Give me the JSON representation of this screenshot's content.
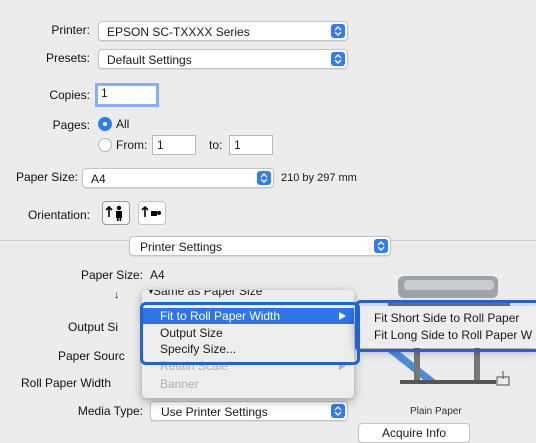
{
  "printer": {
    "label": "Printer:",
    "value": "EPSON SC-TXXXX Series"
  },
  "presets": {
    "label": "Presets:",
    "value": "Default Settings"
  },
  "copies": {
    "label": "Copies:",
    "value": "1"
  },
  "pages": {
    "label": "Pages:",
    "all_label": "All",
    "from_label": "From:",
    "from_value": "1",
    "to_label": "to:",
    "to_value": "1"
  },
  "paper_size": {
    "label": "Paper Size:",
    "value": "A4",
    "dimensions": "210 by 297 mm"
  },
  "orientation": {
    "label": "Orientation:"
  },
  "section_select": {
    "value": "Printer Settings"
  },
  "settings": {
    "paper_size_label": "Paper Size:",
    "paper_size_value": "A4",
    "output_size_label": "Output Si",
    "paper_source_label": "Paper Sourc",
    "roll_paper_width_label": "Roll Paper Width",
    "media_type_label": "Media Type:",
    "media_type_value": "Use Printer Settings",
    "plain_paper_caption": "Plain Paper",
    "acquire_info_label": "Acquire Info"
  },
  "output_menu": {
    "items": [
      {
        "label": "Same as Paper Size",
        "state": "partial"
      },
      {
        "label": "Fit to Roll Paper Width",
        "state": "highlighted",
        "submenu": true
      },
      {
        "label": "Output Size",
        "state": "normal"
      },
      {
        "label": "Specify Size...",
        "state": "normal"
      },
      {
        "label": "Retain Scale",
        "state": "disabled",
        "submenu": true
      },
      {
        "label": "Banner",
        "state": "disabled"
      }
    ]
  },
  "fit_submenu": {
    "items": [
      {
        "label": "Fit Short Side to Roll Paper"
      },
      {
        "label": "Fit Long Side to Roll Paper W"
      }
    ]
  },
  "colors": {
    "accent": "#2f7cf6",
    "highlight": "#2f74e8",
    "callout": "#1f63d6"
  }
}
